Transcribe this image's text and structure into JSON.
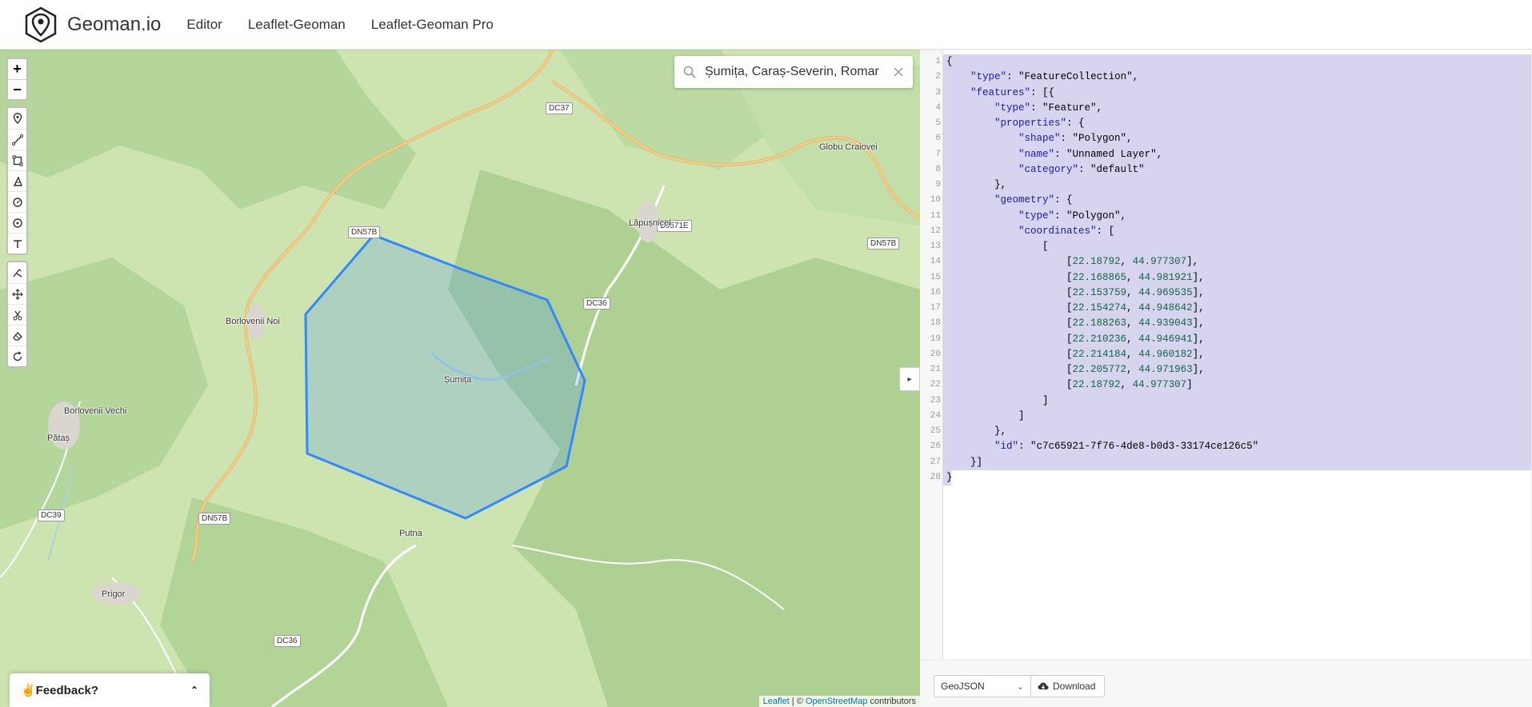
{
  "header": {
    "brand": "Geoman.io",
    "nav": [
      "Editor",
      "Leaflet-Geoman",
      "Leaflet-Geoman Pro"
    ]
  },
  "map": {
    "search_value": "Șumița, Caraș-Severin, Romar",
    "zoom_in": "+",
    "zoom_out": "−",
    "collapse_glyph": "▸",
    "places": [
      "Globu Craiovei",
      "Lăpușnicel",
      "Borlovenii Noi",
      "Șumița",
      "Borlovenii Vechi",
      "Pătaș",
      "Putna",
      "Prigor"
    ],
    "roads": [
      "DC37",
      "DN57B",
      "DJ571E",
      "DN57B",
      "DC36",
      "DC39",
      "DN57B",
      "DC36"
    ],
    "attribution_leaflet": "Leaflet",
    "attribution_sep": " | © ",
    "attribution_osm": "OpenStreetMap",
    "attribution_tail": " contributors",
    "feedback_label": "✌️Feedback?",
    "feedback_chevron": "⌃"
  },
  "tools": {
    "draw": [
      "marker-icon",
      "polyline-icon",
      "rectangle-icon",
      "polygon-icon",
      "circle-icon",
      "circle-marker-icon",
      "text-icon"
    ],
    "edit": [
      "edit-icon",
      "drag-icon",
      "cut-icon",
      "eraser-icon",
      "rotate-icon"
    ]
  },
  "editor": {
    "lines": [
      "{",
      "    \"type\": \"FeatureCollection\",",
      "    \"features\": [{",
      "        \"type\": \"Feature\",",
      "        \"properties\": {",
      "            \"shape\": \"Polygon\",",
      "            \"name\": \"Unnamed Layer\",",
      "            \"category\": \"default\"",
      "        },",
      "        \"geometry\": {",
      "            \"type\": \"Polygon\",",
      "            \"coordinates\": [",
      "                [",
      "                    [22.18792, 44.977307],",
      "                    [22.168865, 44.981921],",
      "                    [22.153759, 44.969535],",
      "                    [22.154274, 44.948642],",
      "                    [22.188263, 44.939043],",
      "                    [22.210236, 44.946941],",
      "                    [22.214184, 44.960182],",
      "                    [22.205772, 44.971963],",
      "                    [22.18792, 44.977307]",
      "                ]",
      "            ]",
      "        },",
      "        \"id\": \"c7c65921-7f76-4de8-b0d3-33174ce126c5\"",
      "    }]",
      "}"
    ]
  },
  "footer": {
    "format": "GeoJSON",
    "download": "Download"
  },
  "colors": {
    "polygon_stroke": "#3388ff",
    "selection": "#d7d4f0"
  }
}
